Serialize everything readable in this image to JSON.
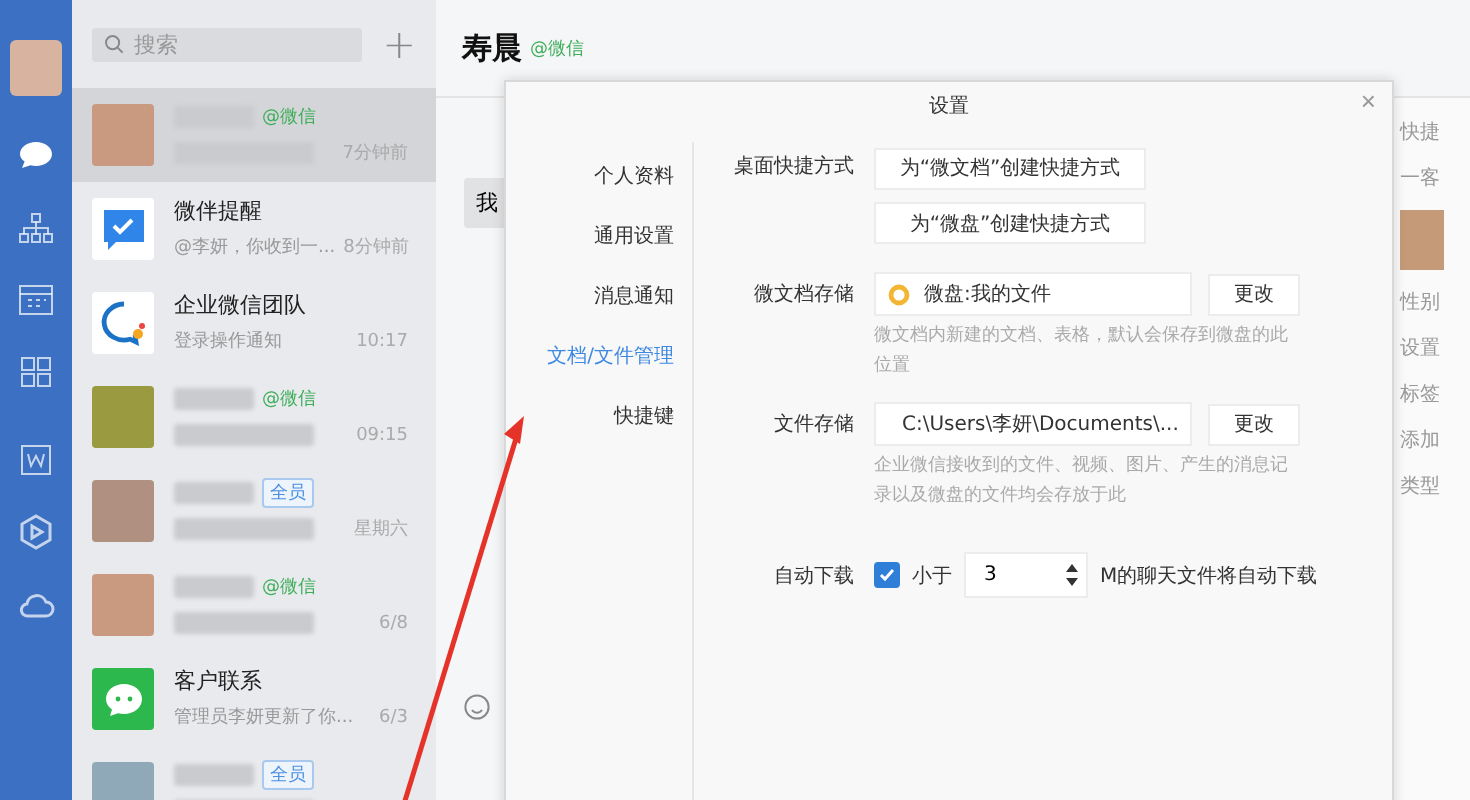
{
  "rail": {
    "items": [
      {
        "kind": "chat",
        "selected": true
      },
      {
        "kind": "org",
        "selected": false
      },
      {
        "kind": "calendar",
        "selected": false
      },
      {
        "kind": "apps",
        "selected": false
      },
      {
        "kind": "doc",
        "selected": false
      },
      {
        "kind": "hex",
        "selected": false
      },
      {
        "kind": "cloud",
        "selected": false
      }
    ]
  },
  "search": {
    "placeholder": "搜索",
    "add": "+"
  },
  "chats": [
    {
      "kind": "blurred",
      "selected": true,
      "tag": {
        "text": "@微信",
        "kind": "wechat"
      },
      "time": "7分钟前"
    },
    {
      "kind": "reminder",
      "selected": false,
      "name": "微伴提醒",
      "preview": "@李妍，你收到一...",
      "time": "8分钟前"
    },
    {
      "kind": "team",
      "selected": false,
      "name": "企业微信团队",
      "preview": "登录操作通知",
      "time": "10:17"
    },
    {
      "kind": "blurred",
      "selected": false,
      "tag": {
        "text": "@微信",
        "kind": "wechat"
      },
      "time": "09:15"
    },
    {
      "kind": "blurred",
      "selected": false,
      "tag": {
        "text": "全员",
        "kind": "all"
      },
      "time": "星期六"
    },
    {
      "kind": "blurred",
      "selected": false,
      "tag": {
        "text": "@微信",
        "kind": "wechat"
      },
      "time": "6/8"
    },
    {
      "kind": "contacts",
      "selected": false,
      "name": "客户联系",
      "preview": "管理员李妍更新了你...",
      "time": "6/3"
    },
    {
      "kind": "blurred",
      "selected": false,
      "tag": {
        "text": "全员",
        "kind": "all"
      }
    }
  ],
  "conversation": {
    "title": "寿晨",
    "tag": "@微信",
    "bubble": "我"
  },
  "side_panel": {
    "items": [
      "快捷",
      "一客",
      "性别",
      "设置",
      "标签",
      "添加",
      "类型"
    ]
  },
  "dialog": {
    "title": "设置",
    "close": "×",
    "nav": [
      {
        "label": "个人资料",
        "selected": false
      },
      {
        "label": "通用设置",
        "selected": false
      },
      {
        "label": "消息通知",
        "selected": false
      },
      {
        "label": "文档/文件管理",
        "selected": true
      },
      {
        "label": "快捷键",
        "selected": false
      }
    ],
    "shortcut": {
      "label": "桌面快捷方式",
      "buttons": [
        "为“微文档”创建快捷方式",
        "为“微盘”创建快捷方式"
      ]
    },
    "doc_storage": {
      "label": "微文档存储",
      "value": "微盘:我的文件",
      "button": "更改",
      "hint": "微文档内新建的文档、表格，默认会保存到微盘的此位置"
    },
    "file_storage": {
      "label": "文件存储",
      "value": "C:\\Users\\李妍\\Documents\\...",
      "button": "更改",
      "hint": "企业微信接收到的文件、视频、图片、产生的消息记录以及微盘的文件均会存放于此"
    },
    "auto_download": {
      "label": "自动下载",
      "checked": true,
      "prefix": "小于",
      "value": "3",
      "suffix": "M的聊天文件将自动下载"
    }
  }
}
